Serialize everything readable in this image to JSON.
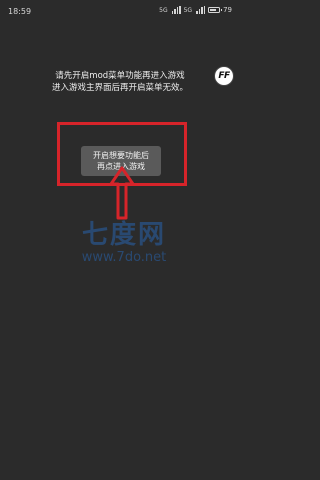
{
  "status_bar": {
    "time": "18:59",
    "signal_1": "5G",
    "signal_2": "5G",
    "battery": "79",
    "battery_level": 0.79
  },
  "notice": {
    "line1": "请先开启mod菜单功能再进入游戏",
    "line2": "进入游戏主界面后再开启菜单无效。"
  },
  "ff_button": {
    "label": "FF"
  },
  "start_tip": {
    "line1": "开启想要功能后",
    "line2": "再点进入游戏"
  },
  "watermark": {
    "logo": "七度网",
    "url": "www.7do.net"
  },
  "colors": {
    "background": "#2b2b2b",
    "highlight": "#d6242a",
    "watermark": "#286ec8"
  }
}
